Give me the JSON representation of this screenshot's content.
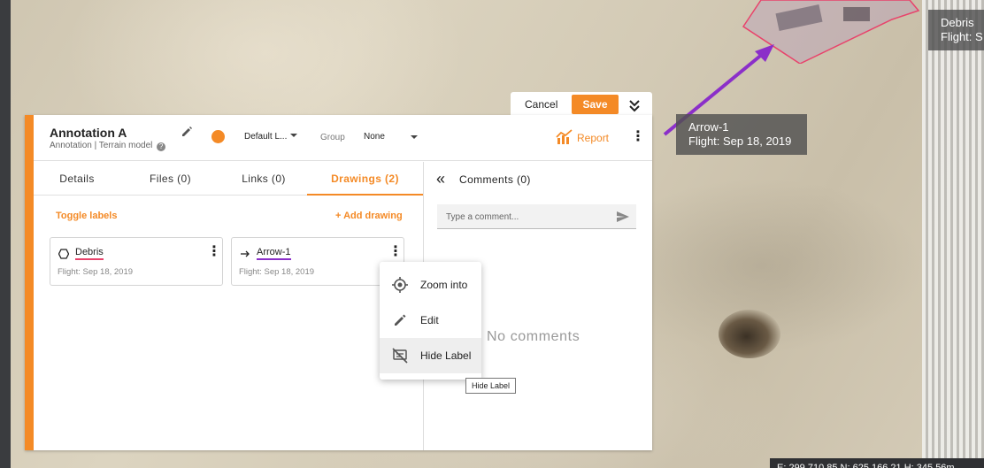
{
  "map": {
    "labels": [
      {
        "name": "Arrow-1",
        "flight": "Flight: Sep 18, 2019"
      },
      {
        "name": "Debris",
        "flight": "Flight: S"
      }
    ],
    "coords": "E: 299,710.85  N: 625,166.21  H: 345.56m",
    "debris_color": "#e8436b",
    "arrow_color": "#8b2fc9"
  },
  "actions": {
    "cancel": "Cancel",
    "save": "Save"
  },
  "header": {
    "title": "Annotation A",
    "subtitle": "Annotation | Terrain model",
    "layer": "Default L...",
    "group_label": "Group",
    "group_value": "None",
    "report": "Report",
    "accent": "#f48a26"
  },
  "tabs": [
    {
      "label": "Details"
    },
    {
      "label": "Files (0)"
    },
    {
      "label": "Links (0)"
    },
    {
      "label": "Drawings (2)",
      "active": true
    }
  ],
  "drawings": {
    "toggle_labels": "Toggle labels",
    "add_drawing": "+ Add drawing",
    "items": [
      {
        "name": "Debris",
        "flight": "Flight: Sep 18, 2019",
        "icon": "hexagon-icon",
        "underline": "#e8436b"
      },
      {
        "name": "Arrow-1",
        "flight": "Flight: Sep 18, 2019",
        "icon": "arrow-right-icon",
        "underline": "#8b2fc9"
      }
    ]
  },
  "comments": {
    "title": "Comments (0)",
    "placeholder": "Type a comment...",
    "empty": "No comments"
  },
  "context_menu": {
    "items": [
      {
        "label": "Zoom into",
        "icon": "target-icon"
      },
      {
        "label": "Edit",
        "icon": "pencil-icon"
      },
      {
        "label": "Hide Label",
        "icon": "hide-label-icon"
      }
    ],
    "tooltip": "Hide Label"
  }
}
